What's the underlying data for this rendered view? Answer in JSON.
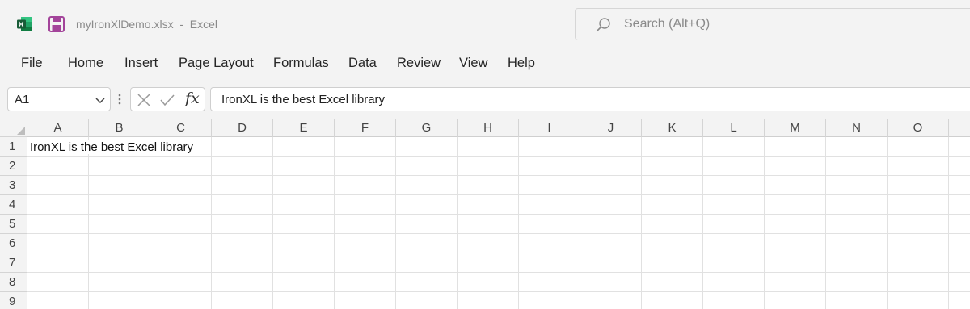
{
  "app": {
    "document_title": "myIronXlDemo.xlsx  -  Excel",
    "search_placeholder": "Search (Alt+Q)",
    "excel_color": "#1d6f42",
    "save_color": "#a3449a"
  },
  "menu": {
    "items": [
      "File",
      "Home",
      "Insert",
      "Page Layout",
      "Formulas",
      "Data",
      "Review",
      "View",
      "Help"
    ]
  },
  "formula_bar": {
    "name_box": "A1",
    "fx_label": "fx",
    "content": "IronXL is the best Excel library"
  },
  "sheet": {
    "columns": [
      "A",
      "B",
      "C",
      "D",
      "E",
      "F",
      "G",
      "H",
      "I",
      "J",
      "K",
      "L",
      "M",
      "N",
      "O"
    ],
    "rows": [
      "1",
      "2",
      "3",
      "4",
      "5",
      "6",
      "7",
      "8",
      "9"
    ],
    "cells": {
      "A1": "IronXL is the best Excel library"
    }
  }
}
